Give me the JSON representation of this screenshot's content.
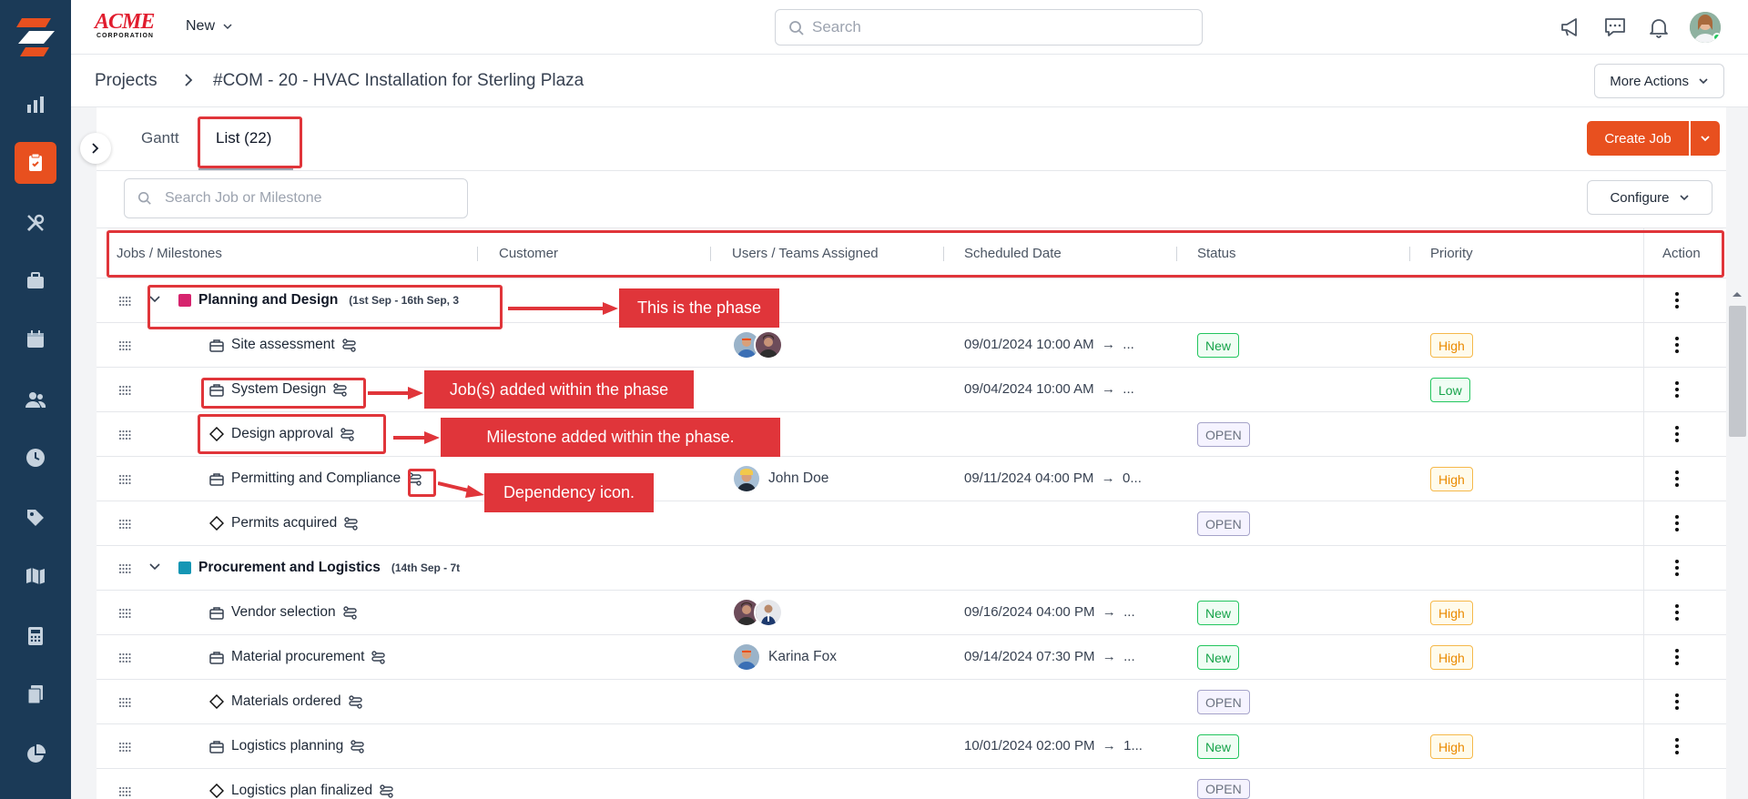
{
  "topbar": {
    "brand_main": "ACME",
    "brand_sub": "CORPORATION",
    "new_label": "New",
    "search_placeholder": "Search"
  },
  "breadcrumb": {
    "root": "Projects",
    "title": "#COM - 20 - HVAC Installation for Sterling Plaza",
    "more_actions": "More Actions"
  },
  "tabs": {
    "gantt": "Gantt",
    "list": "List (22)"
  },
  "toolbar": {
    "create_job": "Create Job",
    "search_placeholder": "Search Job or Milestone",
    "configure": "Configure"
  },
  "table": {
    "columns": [
      "Jobs / Milestones",
      "Customer",
      "Users / Teams Assigned",
      "Scheduled Date",
      "Status",
      "Priority",
      "Action"
    ],
    "phases": [
      {
        "name": "Planning and Design",
        "dates": "(1st Sep - 16th Sep, 3",
        "color": "#d6246e"
      },
      {
        "name": "Procurement and Logistics",
        "dates": "(14th Sep - 7t",
        "color": "#1596b4"
      }
    ],
    "rows": [
      {
        "name": "Site assessment",
        "sched": "09/01/2024 10:00 AM",
        "sched_end": "...",
        "status": "New",
        "priority": "High"
      },
      {
        "name": "System Design",
        "sched": "09/04/2024 10:00 AM",
        "sched_end": "...",
        "status": "",
        "priority": "Low"
      },
      {
        "name": "Design approval",
        "sched": "",
        "status": "OPEN",
        "priority": ""
      },
      {
        "name": "Permitting and Compliance",
        "assignee": "John Doe",
        "sched": "09/11/2024 04:00 PM",
        "sched_end": "0...",
        "status": "",
        "priority": "High"
      },
      {
        "name": "Permits acquired",
        "sched": "",
        "status": "OPEN",
        "priority": ""
      },
      {
        "name": "Vendor selection",
        "sched": "09/16/2024 04:00 PM",
        "sched_end": "...",
        "status": "New",
        "priority": "High"
      },
      {
        "name": "Material procurement",
        "assignee": "Karina Fox",
        "sched": "09/14/2024 07:30 PM",
        "sched_end": "...",
        "status": "New",
        "priority": "High"
      },
      {
        "name": "Materials ordered",
        "sched": "",
        "status": "OPEN",
        "priority": ""
      },
      {
        "name": "Logistics planning",
        "sched": "10/01/2024 02:00 PM",
        "sched_end": "1...",
        "status": "New",
        "priority": "High"
      },
      {
        "name": "Logistics plan finalized",
        "sched": "",
        "status": "OPEN",
        "priority": ""
      }
    ]
  },
  "annotations": {
    "phase": "This is the phase",
    "jobs": "Job(s) added within the phase",
    "milestone": "Milestone added within the phase.",
    "dependency": "Dependency icon."
  },
  "colors": {
    "sidebar": "#1b3a57",
    "accent": "#e8501f",
    "annotation": "#e0353a"
  }
}
